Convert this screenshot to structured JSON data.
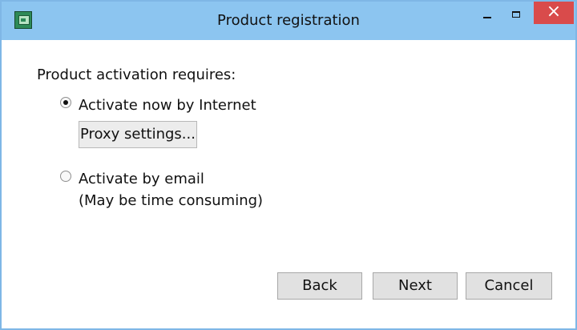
{
  "window": {
    "title": "Product registration"
  },
  "main": {
    "heading": "Product activation requires:",
    "options": [
      {
        "label": "Activate now by Internet",
        "selected": true
      },
      {
        "label": "Activate by email",
        "note": "(May be time consuming)",
        "selected": false
      }
    ],
    "proxy_button": "Proxy settings..."
  },
  "footer": {
    "back_label": "Back",
    "next_label": "Next",
    "cancel_label": "Cancel"
  },
  "icons": {
    "app": "app-icon",
    "minimize": "minimize-icon",
    "maximize": "maximize-icon",
    "close": "close-icon"
  },
  "colors": {
    "titlebar": "#8cc5f0",
    "window_border": "#7fb7e6",
    "close_button": "#d94b4b",
    "button_face": "#e1e1e1"
  }
}
